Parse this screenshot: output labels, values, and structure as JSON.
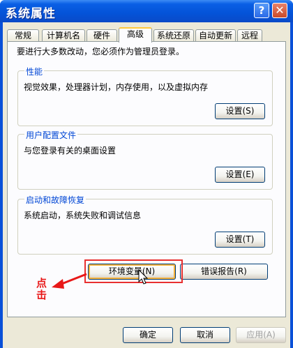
{
  "window": {
    "title": "系统属性",
    "help_glyph": "?",
    "close_glyph": "✕"
  },
  "tabs": [
    {
      "label": "常规",
      "active": false
    },
    {
      "label": "计算机名",
      "active": false
    },
    {
      "label": "硬件",
      "active": false
    },
    {
      "label": "高级",
      "active": true
    },
    {
      "label": "系统还原",
      "active": false
    },
    {
      "label": "自动更新",
      "active": false
    },
    {
      "label": "远程",
      "active": false
    }
  ],
  "intro": "要进行大多数改动，您必须作为管理员登录。",
  "groups": {
    "performance": {
      "title": "性能",
      "description": "视觉效果，处理器计划，内存使用，以及虚拟内存",
      "button": "设置(S)"
    },
    "user_profiles": {
      "title": "用户配置文件",
      "description": "与您登录有关的桌面设置",
      "button": "设置(E)"
    },
    "startup_recovery": {
      "title": "启动和故障恢复",
      "description": "系统启动，系统失败和调试信息",
      "button": "设置(T)"
    }
  },
  "buttons": {
    "env_vars": "环境变量(N)",
    "error_report": "错误报告(R)",
    "ok": "确定",
    "cancel": "取消",
    "apply": "应用(A)"
  },
  "annotation": {
    "text": "点击",
    "color": "#e81818"
  },
  "colors": {
    "titlebar": "#0453d8",
    "group_title": "#0046d5",
    "active_tab_accent": "#ffc83c",
    "highlight_border": "#e83030"
  }
}
